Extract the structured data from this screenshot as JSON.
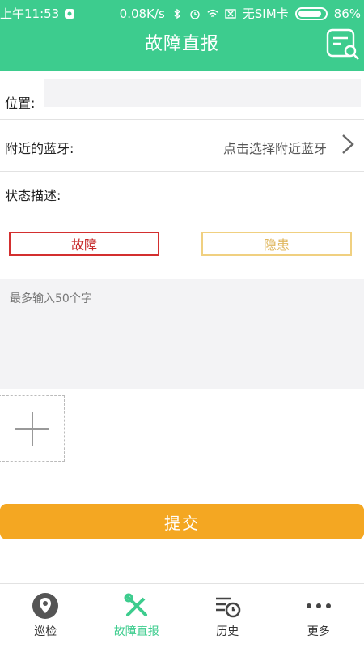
{
  "status_bar": {
    "time": "上午11:53",
    "speed": "0.08K/s",
    "sim": "无SIM卡",
    "battery": "86%"
  },
  "header": {
    "title": "故障直报"
  },
  "form": {
    "location_label": "位置:",
    "location_value": "",
    "bluetooth_label": "附近的蓝牙:",
    "bluetooth_value": "点击选择附近蓝牙",
    "status_label": "状态描述:",
    "status_options": [
      "故障",
      "隐患"
    ],
    "description_placeholder": "最多输入50个字",
    "submit_label": "提交"
  },
  "tabs": [
    {
      "label": "巡检",
      "icon": "location-pin-icon",
      "active": false
    },
    {
      "label": "故障直报",
      "icon": "tools-icon",
      "active": true
    },
    {
      "label": "历史",
      "icon": "history-icon",
      "active": false
    },
    {
      "label": "更多",
      "icon": "more-dots-icon",
      "active": false
    }
  ],
  "colors": {
    "primary": "#3dcc8e",
    "submit": "#f4a722",
    "fault": "#d32f2f",
    "hazard": "#f0d080"
  }
}
